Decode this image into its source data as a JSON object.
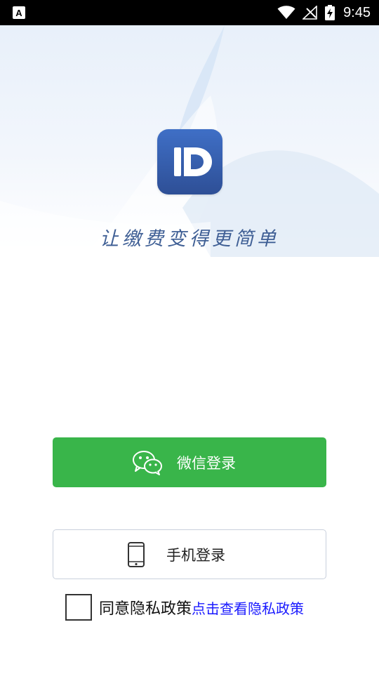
{
  "status_bar": {
    "time": "9:45",
    "icons": [
      "app-notification-icon",
      "wifi-icon",
      "no-signal-icon",
      "battery-charging-icon"
    ]
  },
  "hero": {
    "logo_letter": "D",
    "slogan": "让缴费变得更简单"
  },
  "login": {
    "wechat_label": "微信登录",
    "wechat_icon": "wechat-icon",
    "phone_label": "手机登录",
    "phone_icon": "mobile-phone-icon",
    "wechat_color": "#39b54a"
  },
  "agreement": {
    "checked": false,
    "text": "同意隐私政策",
    "link_text": "点击查看隐私政策",
    "link_color": "#1a1aff"
  }
}
